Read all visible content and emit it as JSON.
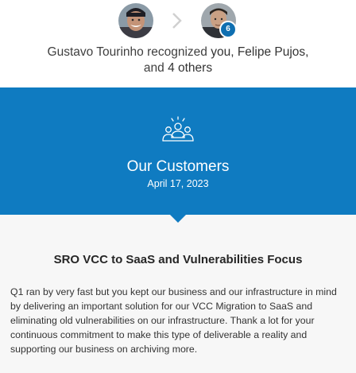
{
  "recognition": {
    "giver_name": "Gustavo Tourinho",
    "verb": "recognized",
    "recipient_self": "you,",
    "recipient_name": "Felipe Pujos,",
    "and_text": "and",
    "others": "4 others",
    "recipient_count_badge": "6"
  },
  "banner": {
    "title": "Our Customers",
    "date": "April 17, 2023",
    "icon": "people-group-icon",
    "color": "#0f7bc1"
  },
  "post": {
    "title": "SRO VCC to SaaS and Vulnerabilities Focus",
    "body": "Q1 ran by very fast but you kept our business and our infrastructure in mind by delivering an important solution for our VCC Migration to SaaS and eliminating old vulnerabilities on our infrastructure. Thank a lot for your continuous commitment to make this type of deliverable a reality and supporting our business on archiving more."
  },
  "colors": {
    "badge": "#0f6fb1",
    "content_background": "#f7f7f7"
  }
}
